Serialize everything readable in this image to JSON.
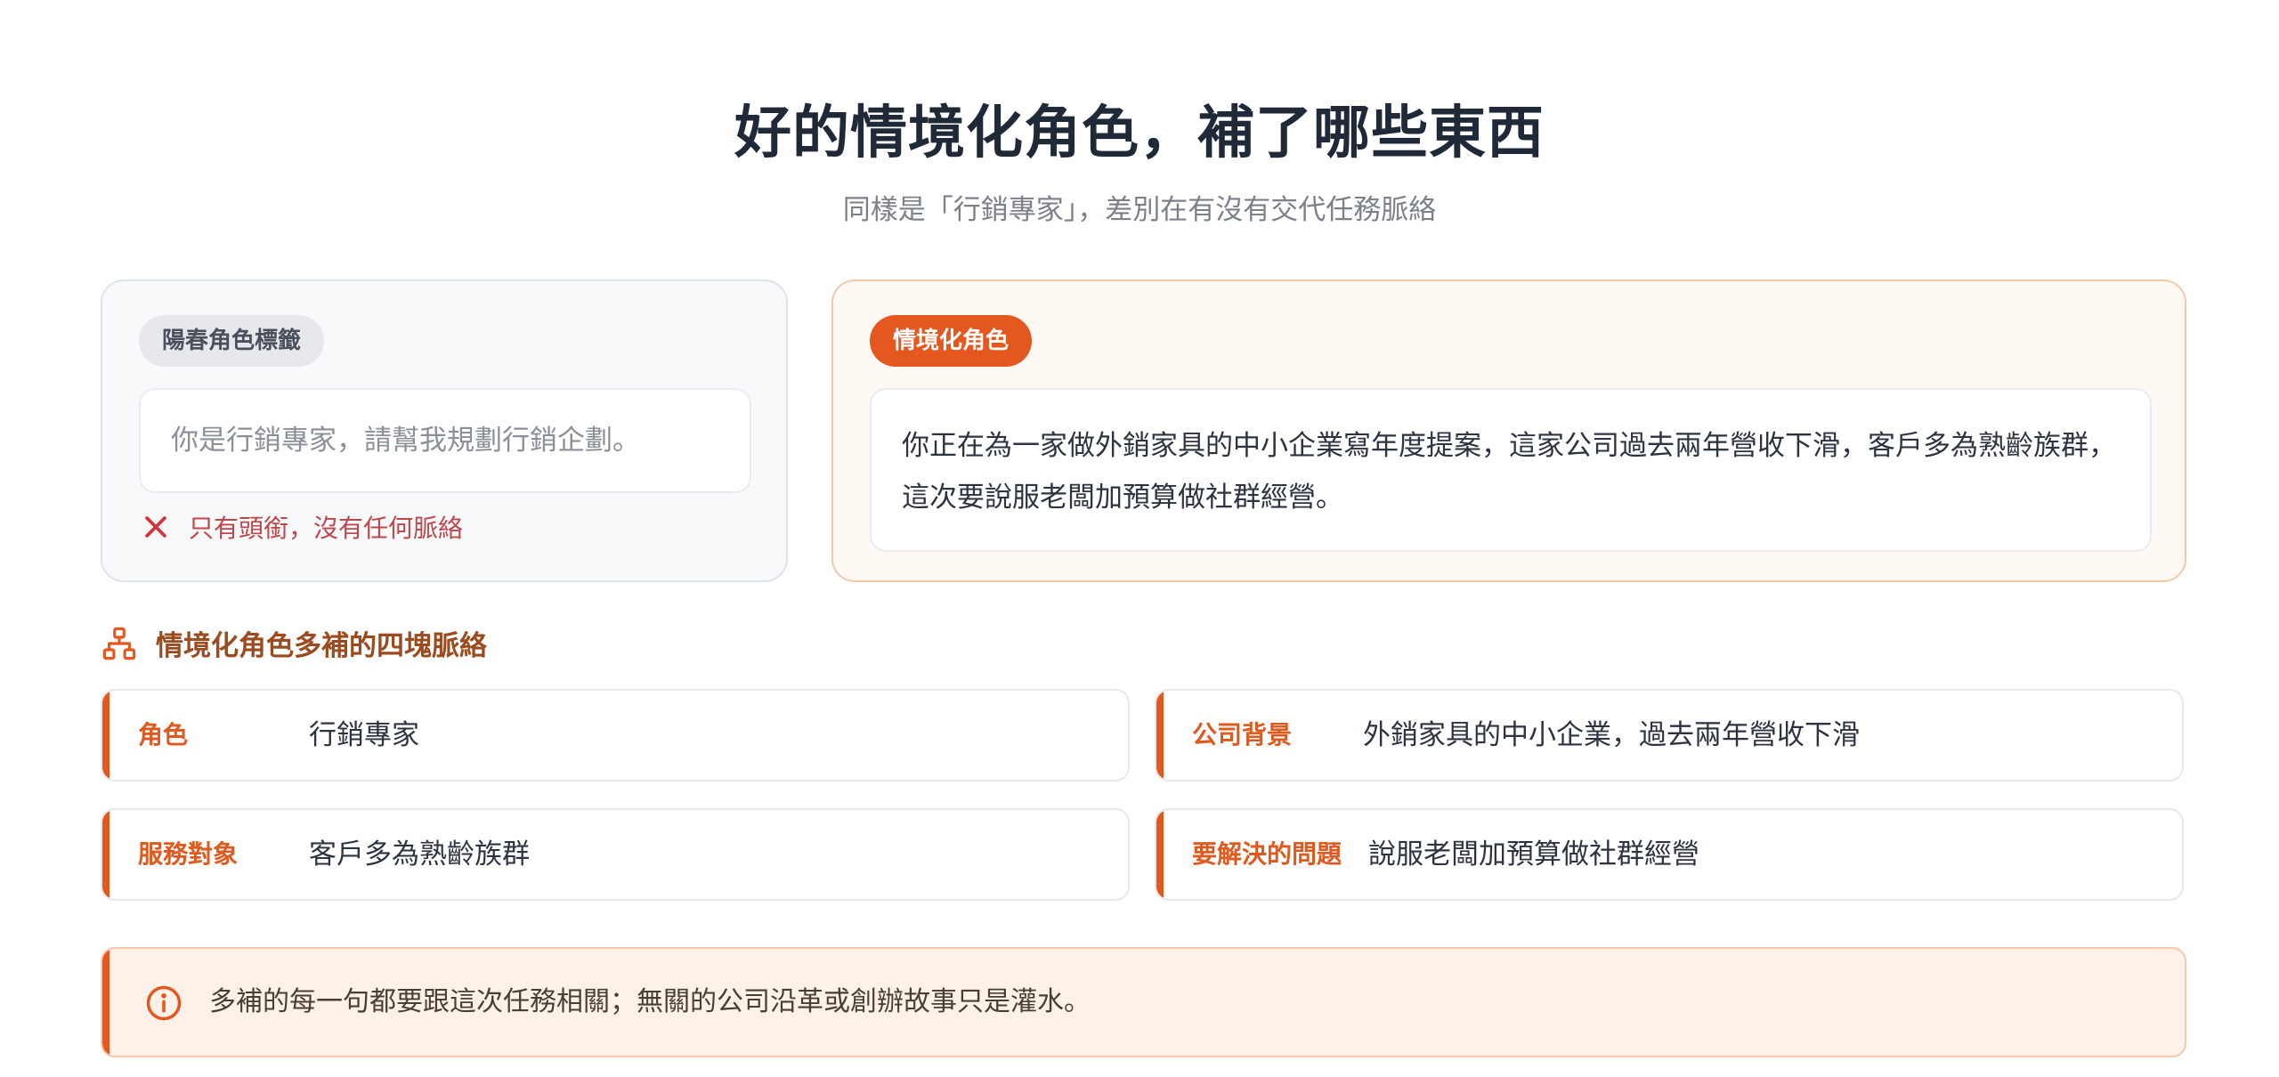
{
  "header": {
    "title": "好的情境化角色，補了哪些東西",
    "subtitle": "同樣是「行銷專家」，差別在有沒有交代任務脈絡"
  },
  "plain_card": {
    "badge": "陽春角色標籤",
    "prompt": "你是行銷專家，請幫我規劃行銷企劃。",
    "note": "只有頭銜，沒有任何脈絡",
    "note_icon": "close-icon"
  },
  "rich_card": {
    "badge": "情境化角色",
    "prompt": "你正在為一家做外銷家具的中小企業寫年度提案，這家公司過去兩年營收下滑，客戶多為熟齡族群，這次要說服老闆加預算做社群經營。"
  },
  "section": {
    "heading": "情境化角色多補的四塊脈絡",
    "icon": "hierarchy-icon"
  },
  "context_items": [
    {
      "label": "角色",
      "value": "行銷專家"
    },
    {
      "label": "公司背景",
      "value": "外銷家具的中小企業，過去兩年營收下滑"
    },
    {
      "label": "服務對象",
      "value": "客戶多為熟齡族群"
    },
    {
      "label": "要解決的問題",
      "value": "說服老闆加預算做社群經營"
    }
  ],
  "banner": {
    "text": "多補的每一句都要跟這次任務相關；無關的公司沿革或創辦故事只是灌水。",
    "icon": "info-icon"
  },
  "colors": {
    "accent": "#e4571f",
    "negative": "#c0464a",
    "heading": "#1f2937"
  }
}
